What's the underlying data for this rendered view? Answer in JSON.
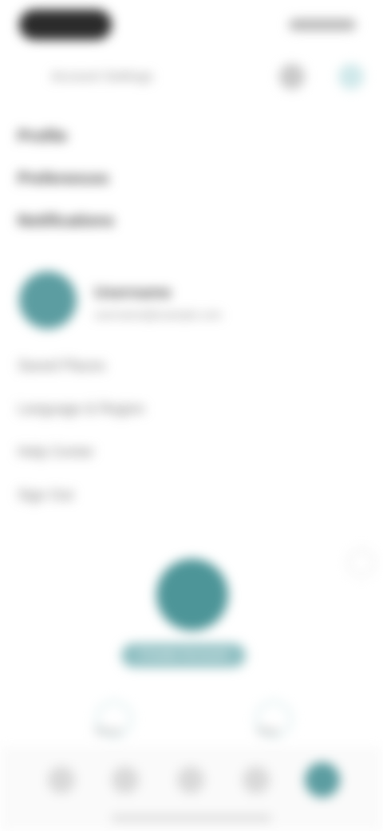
{
  "header": {
    "title": "Account Settings"
  },
  "menu": {
    "items": [
      {
        "label": "Profile"
      },
      {
        "label": "Preferences"
      },
      {
        "label": "Notifications"
      }
    ]
  },
  "profile": {
    "name": "Username",
    "subtitle": "username@example.com"
  },
  "settings": {
    "items": [
      {
        "label": "Saved Places"
      },
      {
        "label": "Language & Region"
      },
      {
        "label": "Help Center"
      },
      {
        "label": "Sign Out"
      }
    ]
  },
  "cta": {
    "label": "Create Account"
  },
  "shortcuts": [
    {
      "label": "Share"
    },
    {
      "label": "Rate"
    }
  ],
  "colors": {
    "accent": "#5c9da1",
    "accent_light": "#cfe8ea"
  },
  "icons": {
    "header_actions": [
      "search-icon",
      "share-icon"
    ],
    "nav": [
      "home-icon",
      "explore-icon",
      "map-icon",
      "saved-icon",
      "profile-icon"
    ],
    "close": "close-icon"
  }
}
